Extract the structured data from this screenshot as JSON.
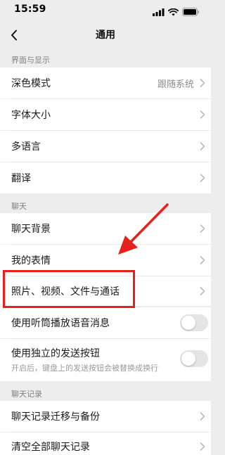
{
  "status_bar": {
    "time": "15:59",
    "icons": [
      "signal-icon",
      "wifi-icon",
      "battery-icon"
    ]
  },
  "nav": {
    "title": "通用",
    "back_icon": "chevron-left-icon"
  },
  "sections": {
    "display": {
      "header": "界面与显示"
    },
    "chat": {
      "header": "聊天"
    },
    "history": {
      "header": "聊天记录"
    }
  },
  "rows": {
    "dark_mode": {
      "label": "深色模式",
      "value": "跟随系统"
    },
    "font_size": {
      "label": "字体大小"
    },
    "language": {
      "label": "多语言"
    },
    "translate": {
      "label": "翻译"
    },
    "chat_background": {
      "label": "聊天背景"
    },
    "my_stickers": {
      "label": "我的表情"
    },
    "media": {
      "label": "照片、视频、文件与通话"
    },
    "earpiece": {
      "label": "使用听筒播放语音消息",
      "on": false
    },
    "send_button": {
      "label": "使用独立的发送按钮",
      "sub": "开启后，键盘上的发送按钮会被替换成换行",
      "on": false
    },
    "migrate": {
      "label": "聊天记录迁移与备份"
    },
    "clear_all": {
      "label": "清空全部聊天记录"
    }
  },
  "colors": {
    "annotation": "#e8201c",
    "background": "#ededed",
    "cell": "#ffffff"
  }
}
